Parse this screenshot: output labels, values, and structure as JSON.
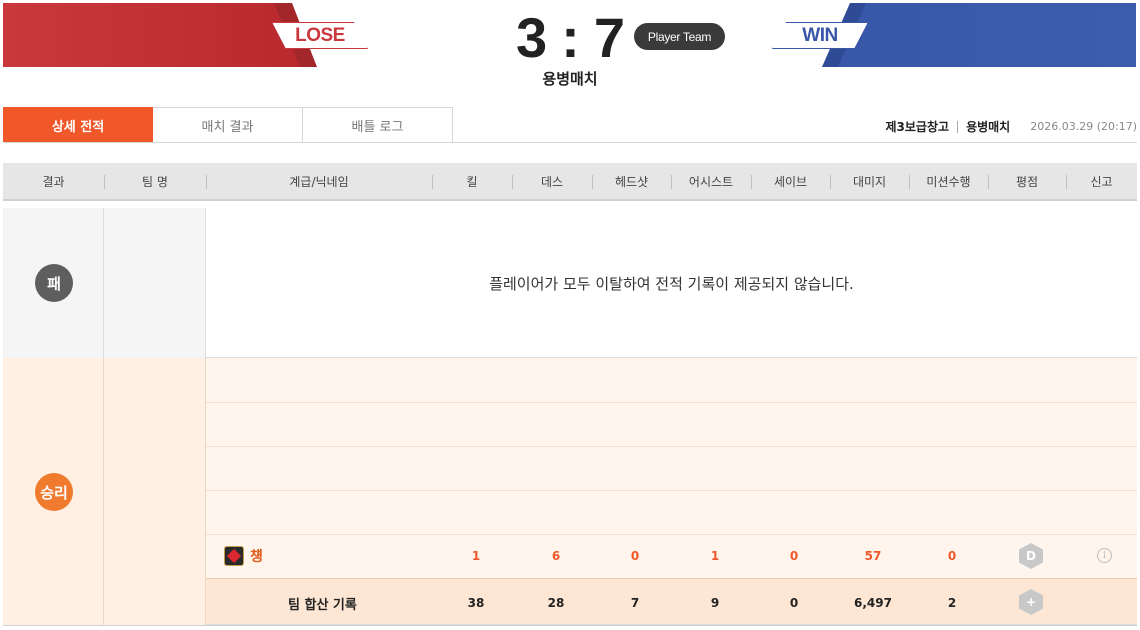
{
  "header": {
    "lose_label": "LOSE",
    "win_label": "WIN",
    "score_left": "3",
    "score_sep": ":",
    "score_right": "7",
    "player_team_badge": "Player Team",
    "mode_subtitle": "용병매치",
    "colors": {
      "lose": "#c9383c",
      "win": "#3957a8",
      "accent": "#f0582a"
    }
  },
  "tabs": [
    {
      "label": "상세 전적",
      "active": true
    },
    {
      "label": "매치 결과",
      "active": false
    },
    {
      "label": "배틀 로그",
      "active": false
    }
  ],
  "match_info": {
    "map": "제3보급창고",
    "mode": "용병매치",
    "datetime": "2026.03.29 (20:17)"
  },
  "columns": [
    "결과",
    "팀 명",
    "계급/닉네임",
    "킬",
    "데스",
    "헤드샷",
    "어시스트",
    "세이브",
    "대미지",
    "미션수행",
    "평점",
    "신고"
  ],
  "lose_team": {
    "result": "패",
    "message": "플레이어가 모두 이탈하여 전적 기록이 제공되지 않습니다."
  },
  "win_team": {
    "result": "승리",
    "player": {
      "nickname": "첑",
      "rank_icon": "rank-emblem-icon",
      "kill": "1",
      "death": "6",
      "headshot": "0",
      "assist": "1",
      "save": "0",
      "damage": "57",
      "mission": "0",
      "grade": "D",
      "report_icon": "info-icon",
      "report_glyph": "i"
    },
    "total": {
      "label": "팀 합산 기록",
      "kill": "38",
      "death": "28",
      "headshot": "7",
      "assist": "9",
      "save": "0",
      "damage": "6,497",
      "mission": "2",
      "grade_icon": "add-hex-icon",
      "grade_glyph": "+"
    }
  }
}
